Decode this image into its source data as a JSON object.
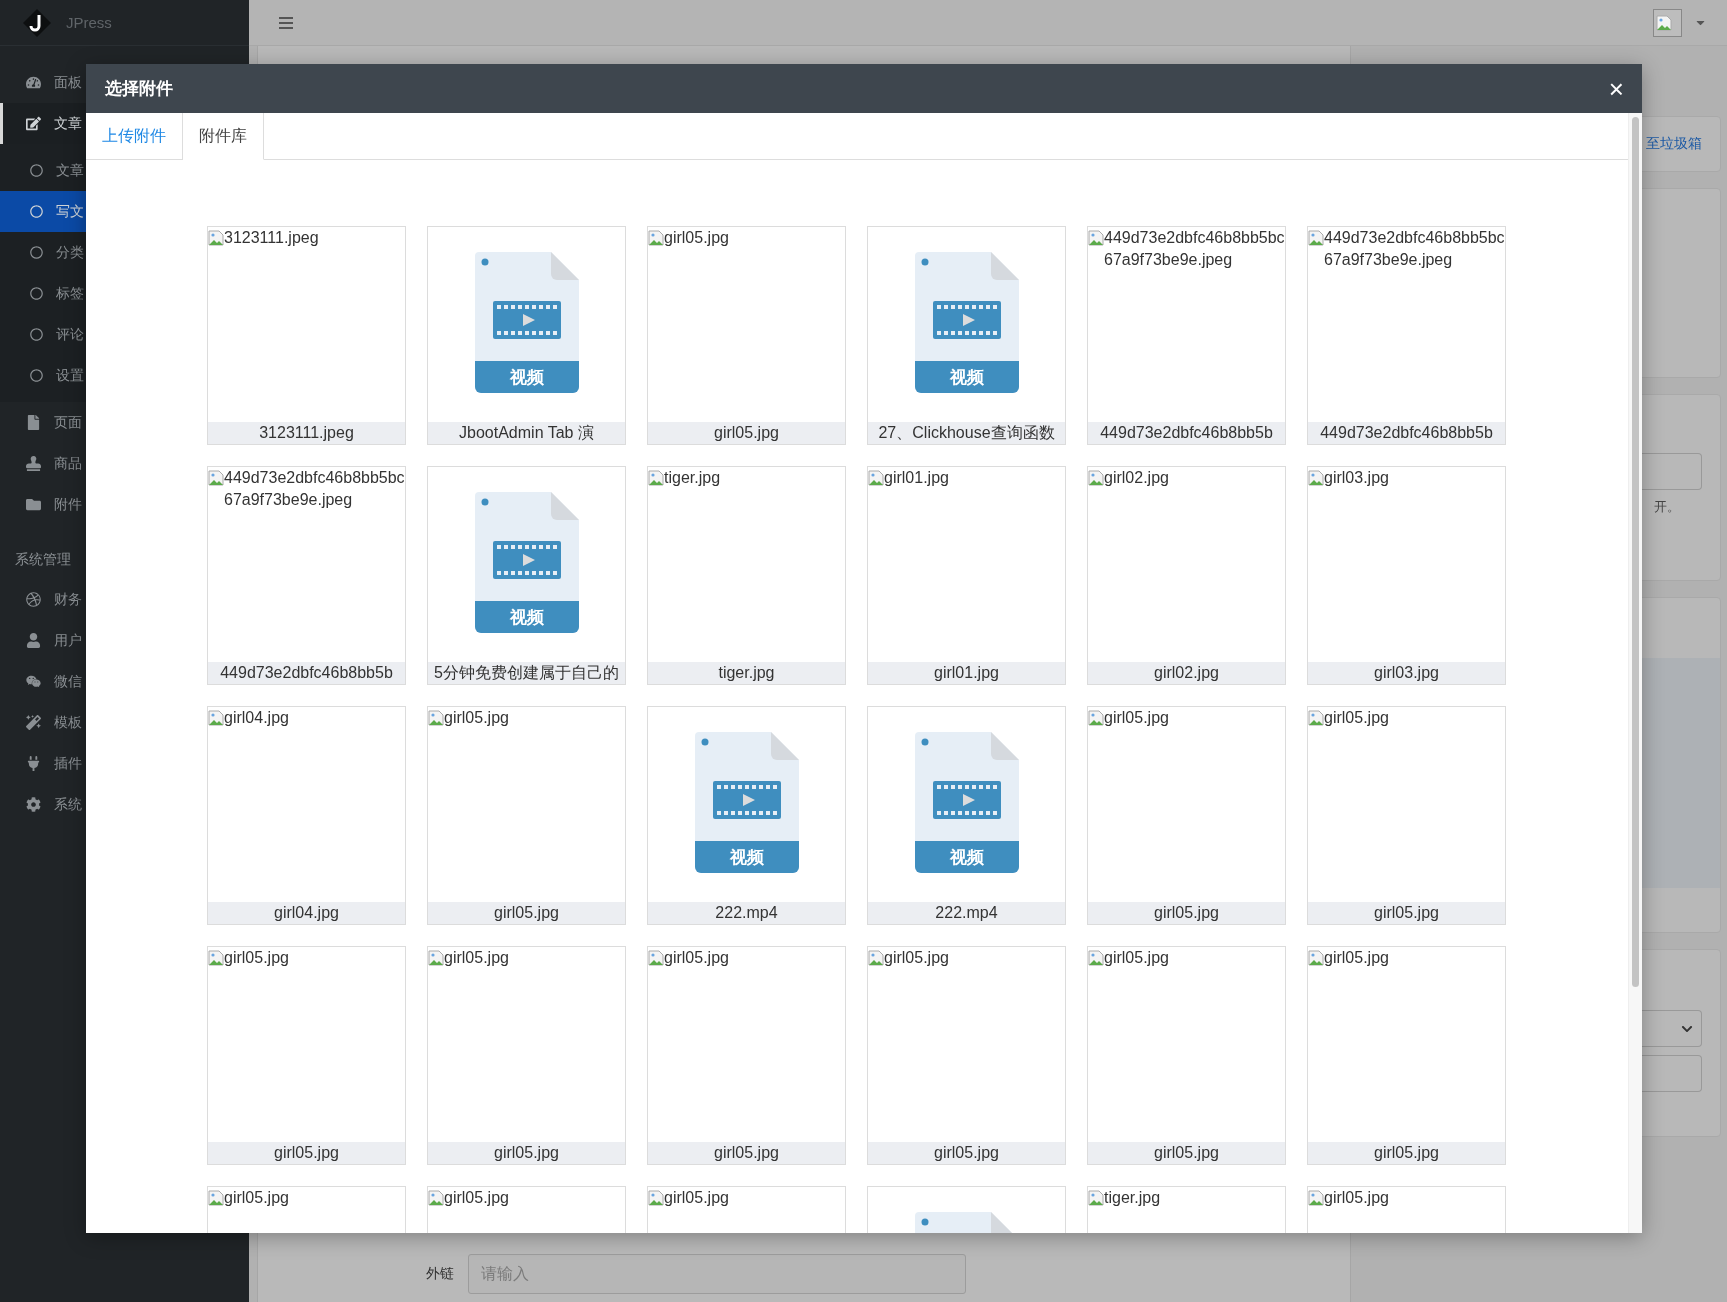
{
  "sidebar": {
    "brand": "JPress",
    "items": [
      {
        "label": "面板",
        "selected": false
      },
      {
        "label": "文章",
        "selected": true,
        "expanded": true,
        "children": [
          {
            "label": "文章",
            "selected": false
          },
          {
            "label": "写文",
            "selected": true
          },
          {
            "label": "分类",
            "selected": false
          },
          {
            "label": "标签",
            "selected": false
          },
          {
            "label": "评论",
            "selected": false
          },
          {
            "label": "设置",
            "selected": false
          }
        ]
      },
      {
        "label": "页面",
        "selected": false
      },
      {
        "label": "商品",
        "selected": false
      },
      {
        "label": "附件",
        "selected": false
      }
    ],
    "section": "系统管理",
    "system_items": [
      {
        "label": "财务",
        "selected": false
      },
      {
        "label": "用户",
        "selected": false
      },
      {
        "label": "微信",
        "selected": false
      },
      {
        "label": "模板",
        "selected": false
      },
      {
        "label": "插件",
        "selected": false
      },
      {
        "label": "系统",
        "selected": false
      }
    ]
  },
  "side_panel": {
    "trash_link": "至垃圾箱",
    "hint": "开。"
  },
  "editor": {
    "link_label": "外链",
    "link_placeholder": "请输入"
  },
  "modal": {
    "title": "选择附件",
    "close": "×",
    "tabs": [
      {
        "label": "上传附件",
        "selected": false
      },
      {
        "label": "附件库",
        "selected": true
      }
    ],
    "files": [
      {
        "kind": "image",
        "alt": "3123111.jpeg",
        "caption": "3123111.jpeg"
      },
      {
        "kind": "video",
        "badge": "视频",
        "caption": "JbootAdmin Tab 演"
      },
      {
        "kind": "image",
        "alt": "girl05.jpg",
        "caption": "girl05.jpg"
      },
      {
        "kind": "video",
        "badge": "视频",
        "caption": "27、Clickhouse查询函数"
      },
      {
        "kind": "image",
        "alt": "449d73e2dbfc46b8bb5bc67a9f73be9e.jpeg",
        "caption": "449d73e2dbfc46b8bb5b"
      },
      {
        "kind": "image",
        "alt": "449d73e2dbfc46b8bb5bc67a9f73be9e.jpeg",
        "caption": "449d73e2dbfc46b8bb5b"
      },
      {
        "kind": "image",
        "alt": "449d73e2dbfc46b8bb5bc67a9f73be9e.jpeg",
        "caption": "449d73e2dbfc46b8bb5b"
      },
      {
        "kind": "video",
        "badge": "视频",
        "caption": "5分钟免费创建属于自己的"
      },
      {
        "kind": "image",
        "alt": "tiger.jpg",
        "caption": "tiger.jpg"
      },
      {
        "kind": "image",
        "alt": "girl01.jpg",
        "caption": "girl01.jpg"
      },
      {
        "kind": "image",
        "alt": "girl02.jpg",
        "caption": "girl02.jpg"
      },
      {
        "kind": "image",
        "alt": "girl03.jpg",
        "caption": "girl03.jpg"
      },
      {
        "kind": "image",
        "alt": "girl04.jpg",
        "caption": "girl04.jpg"
      },
      {
        "kind": "image",
        "alt": "girl05.jpg",
        "caption": "girl05.jpg"
      },
      {
        "kind": "video",
        "badge": "视频",
        "caption": "222.mp4"
      },
      {
        "kind": "video",
        "badge": "视频",
        "caption": "222.mp4"
      },
      {
        "kind": "image",
        "alt": "girl05.jpg",
        "caption": "girl05.jpg"
      },
      {
        "kind": "image",
        "alt": "girl05.jpg",
        "caption": "girl05.jpg"
      },
      {
        "kind": "image",
        "alt": "girl05.jpg",
        "caption": "girl05.jpg"
      },
      {
        "kind": "image",
        "alt": "girl05.jpg",
        "caption": "girl05.jpg"
      },
      {
        "kind": "image",
        "alt": "girl05.jpg",
        "caption": "girl05.jpg"
      },
      {
        "kind": "image",
        "alt": "girl05.jpg",
        "caption": "girl05.jpg"
      },
      {
        "kind": "image",
        "alt": "girl05.jpg",
        "caption": "girl05.jpg"
      },
      {
        "kind": "image",
        "alt": "girl05.jpg",
        "caption": "girl05.jpg"
      },
      {
        "kind": "image",
        "alt": "girl05.jpg"
      },
      {
        "kind": "image",
        "alt": "girl05.jpg"
      },
      {
        "kind": "image",
        "alt": "girl05.jpg"
      },
      {
        "kind": "video"
      },
      {
        "kind": "image",
        "alt": "tiger.jpg"
      },
      {
        "kind": "image",
        "alt": "girl05.jpg"
      }
    ]
  }
}
